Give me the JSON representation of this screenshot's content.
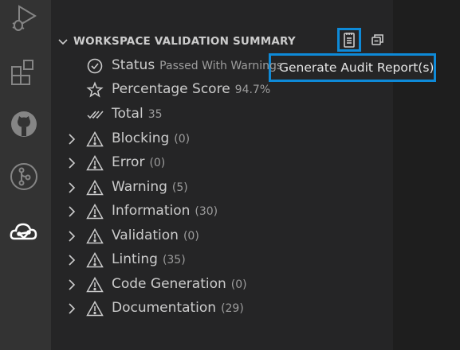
{
  "activity_bar": {
    "icons": [
      "run-debug-icon",
      "extensions-icon",
      "github-icon",
      "source-control-graph-icon",
      "cloud-icon"
    ]
  },
  "panel": {
    "title": "WORKSPACE VALIDATION SUMMARY",
    "tooltip": "Generate Audit Report(s)"
  },
  "summary": [
    {
      "label": "Status",
      "value": "Passed With Warnings"
    },
    {
      "label": "Percentage Score",
      "value": "94.7%"
    },
    {
      "label": "Total",
      "value": "35"
    }
  ],
  "categories": [
    {
      "label": "Blocking",
      "count": "(0)"
    },
    {
      "label": "Error",
      "count": "(0)"
    },
    {
      "label": "Warning",
      "count": "(5)"
    },
    {
      "label": "Information",
      "count": "(30)"
    },
    {
      "label": "Validation",
      "count": "(0)"
    },
    {
      "label": "Linting",
      "count": "(35)"
    },
    {
      "label": "Code Generation",
      "count": "(0)"
    },
    {
      "label": "Documentation",
      "count": "(29)"
    }
  ],
  "colors": {
    "accent_border": "#0e8ad8",
    "background": "#252526",
    "activity_bar": "#333333"
  }
}
